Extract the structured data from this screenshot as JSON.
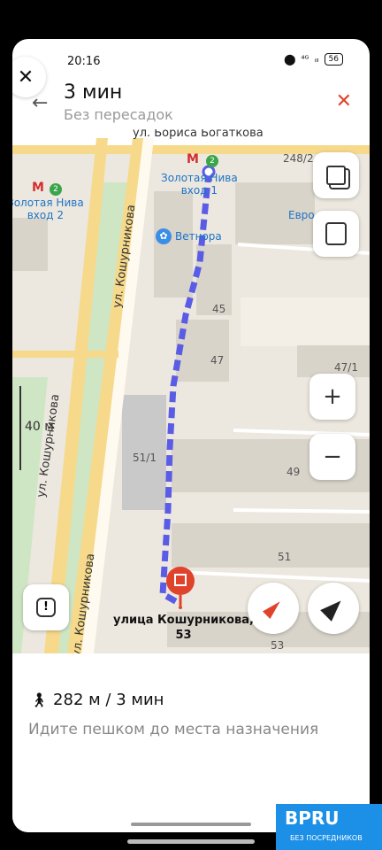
{
  "status_bar": {
    "time": "20:16",
    "network": "⁴ᴳ",
    "signal": "ᵢₗₗ",
    "battery": "56"
  },
  "header": {
    "route_time": "3 мин",
    "route_subtitle": "Без пересадок"
  },
  "map": {
    "street_top": "ул. Бориса Богаткова",
    "street_kosh_vertical": "ул. Кошурникова",
    "street_kosh_lower": "ул. Кошурникова",
    "street_kosh_bottom": "ул. Кошурникова",
    "metro_1": "Золотая Нива\nвход 1",
    "metro_2": "Золотая Нива\nвход 2",
    "metro_line": "2",
    "shop_vetnora": "Ветнора",
    "shop_euro": "Евро",
    "houses": [
      "248/2",
      "45",
      "47",
      "47/1",
      "51/1",
      "49",
      "51",
      "53"
    ],
    "scale": "40 м",
    "destination": "улица Кошурникова,\n53"
  },
  "summary": {
    "walk_icon": "walk-icon",
    "walk_info": "282 м / 3 мин",
    "description": "Идите пешком до места назначения"
  },
  "watermark": {
    "brand": "BPRU",
    "tagline": "БЕЗ ПОСРЕДНИКОВ"
  },
  "colors": {
    "route": "#5a5ce6",
    "accent_red": "#e0432b",
    "metro_red": "#d42d2d",
    "metro_green": "#3aa54a"
  }
}
